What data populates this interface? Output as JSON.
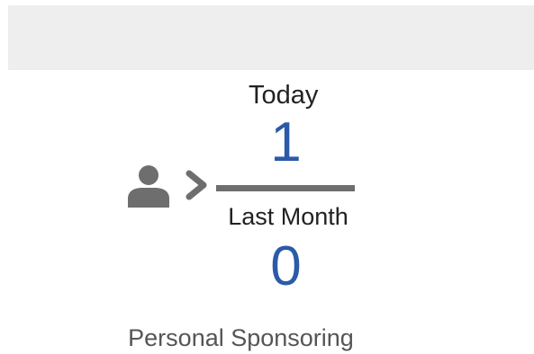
{
  "stats": {
    "today_label": "Today",
    "today_value": "1",
    "last_month_label": "Last Month",
    "last_month_value": "0"
  },
  "widget": {
    "title": "Personal Sponsoring",
    "icons": [
      "user-icon",
      "chevron-right-icon"
    ]
  },
  "colors": {
    "value": "#2b5aa8",
    "icon": "#6e6e6e",
    "header_bar": "#eeeeee",
    "title": "#555555"
  }
}
